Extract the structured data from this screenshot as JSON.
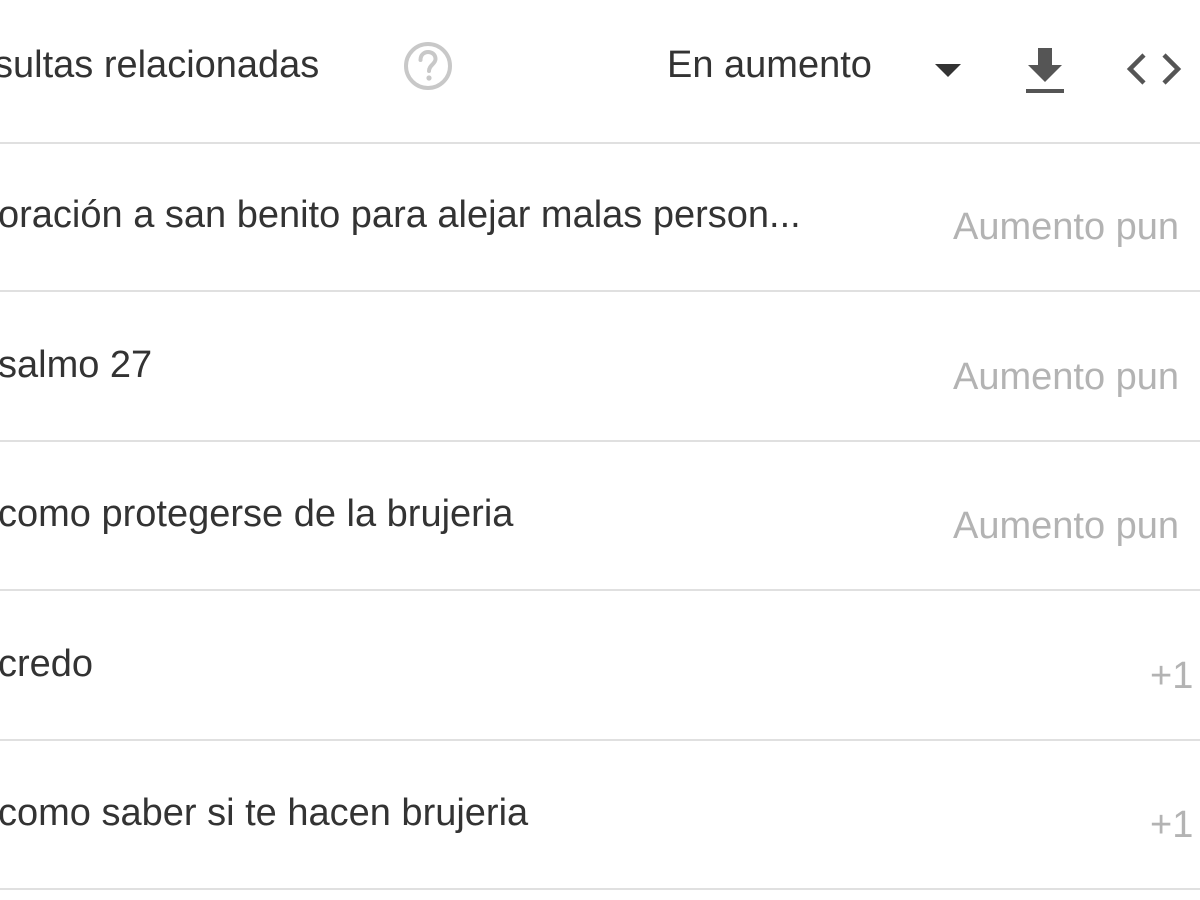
{
  "header": {
    "title": "sultas relacionadas",
    "help_icon": "help-circle-icon",
    "select": {
      "selected": "En aumento"
    },
    "download_icon": "download-icon",
    "embed_icon": "code-icon"
  },
  "rows": [
    {
      "label": "oración a san benito para alejar malas person...",
      "value": "Aumento pun"
    },
    {
      "label": "salmo 27",
      "value": "Aumento pun"
    },
    {
      "label": "como protegerse de la brujeria",
      "value": "Aumento pun"
    },
    {
      "label": "credo",
      "value": "+1"
    },
    {
      "label": "como saber si te hacen brujeria",
      "value": "+1"
    }
  ]
}
